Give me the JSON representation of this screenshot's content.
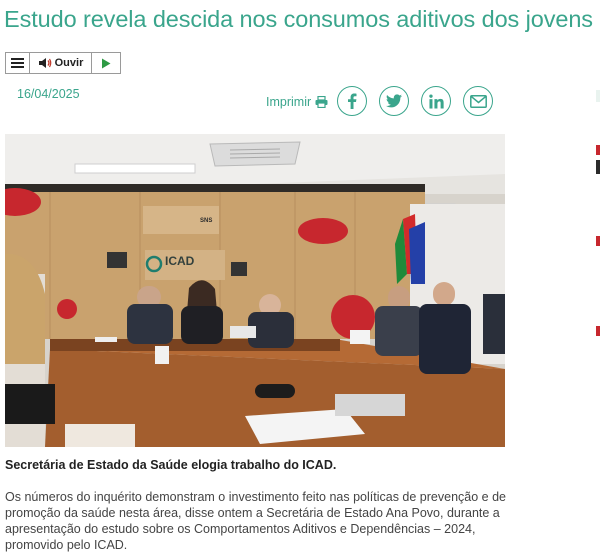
{
  "article": {
    "title": "Estudo revela descida nos consumos aditivos dos jovens",
    "date": "16/04/2025",
    "image_caption": "Secretária de Estado da Saúde elogia trabalho do ICAD.",
    "body": "Os números do inquérito demonstram o investimento feito nas políticas de prevenção e de promoção da saúde nesta área, disse ontem a Secretária de Estado Ana Povo, durante a apresentação do estudo sobre os Comportamentos Aditivos e Dependências – 2024, promovido pelo ICAD."
  },
  "player": {
    "listen_label": "Ouvir",
    "menu_icon": "hamburger-icon",
    "speaker_icon": "speaker-icon",
    "play_icon": "play-icon"
  },
  "toolbar": {
    "print_label": "Imprimir",
    "share_buttons": [
      "facebook",
      "twitter",
      "linkedin",
      "email"
    ]
  },
  "photo": {
    "wall_text_icad": "ICAD",
    "wall_text_sns": "SNS"
  },
  "colors": {
    "accent": "#3aa58c",
    "title": "#3aa58c",
    "text": "#444444"
  }
}
